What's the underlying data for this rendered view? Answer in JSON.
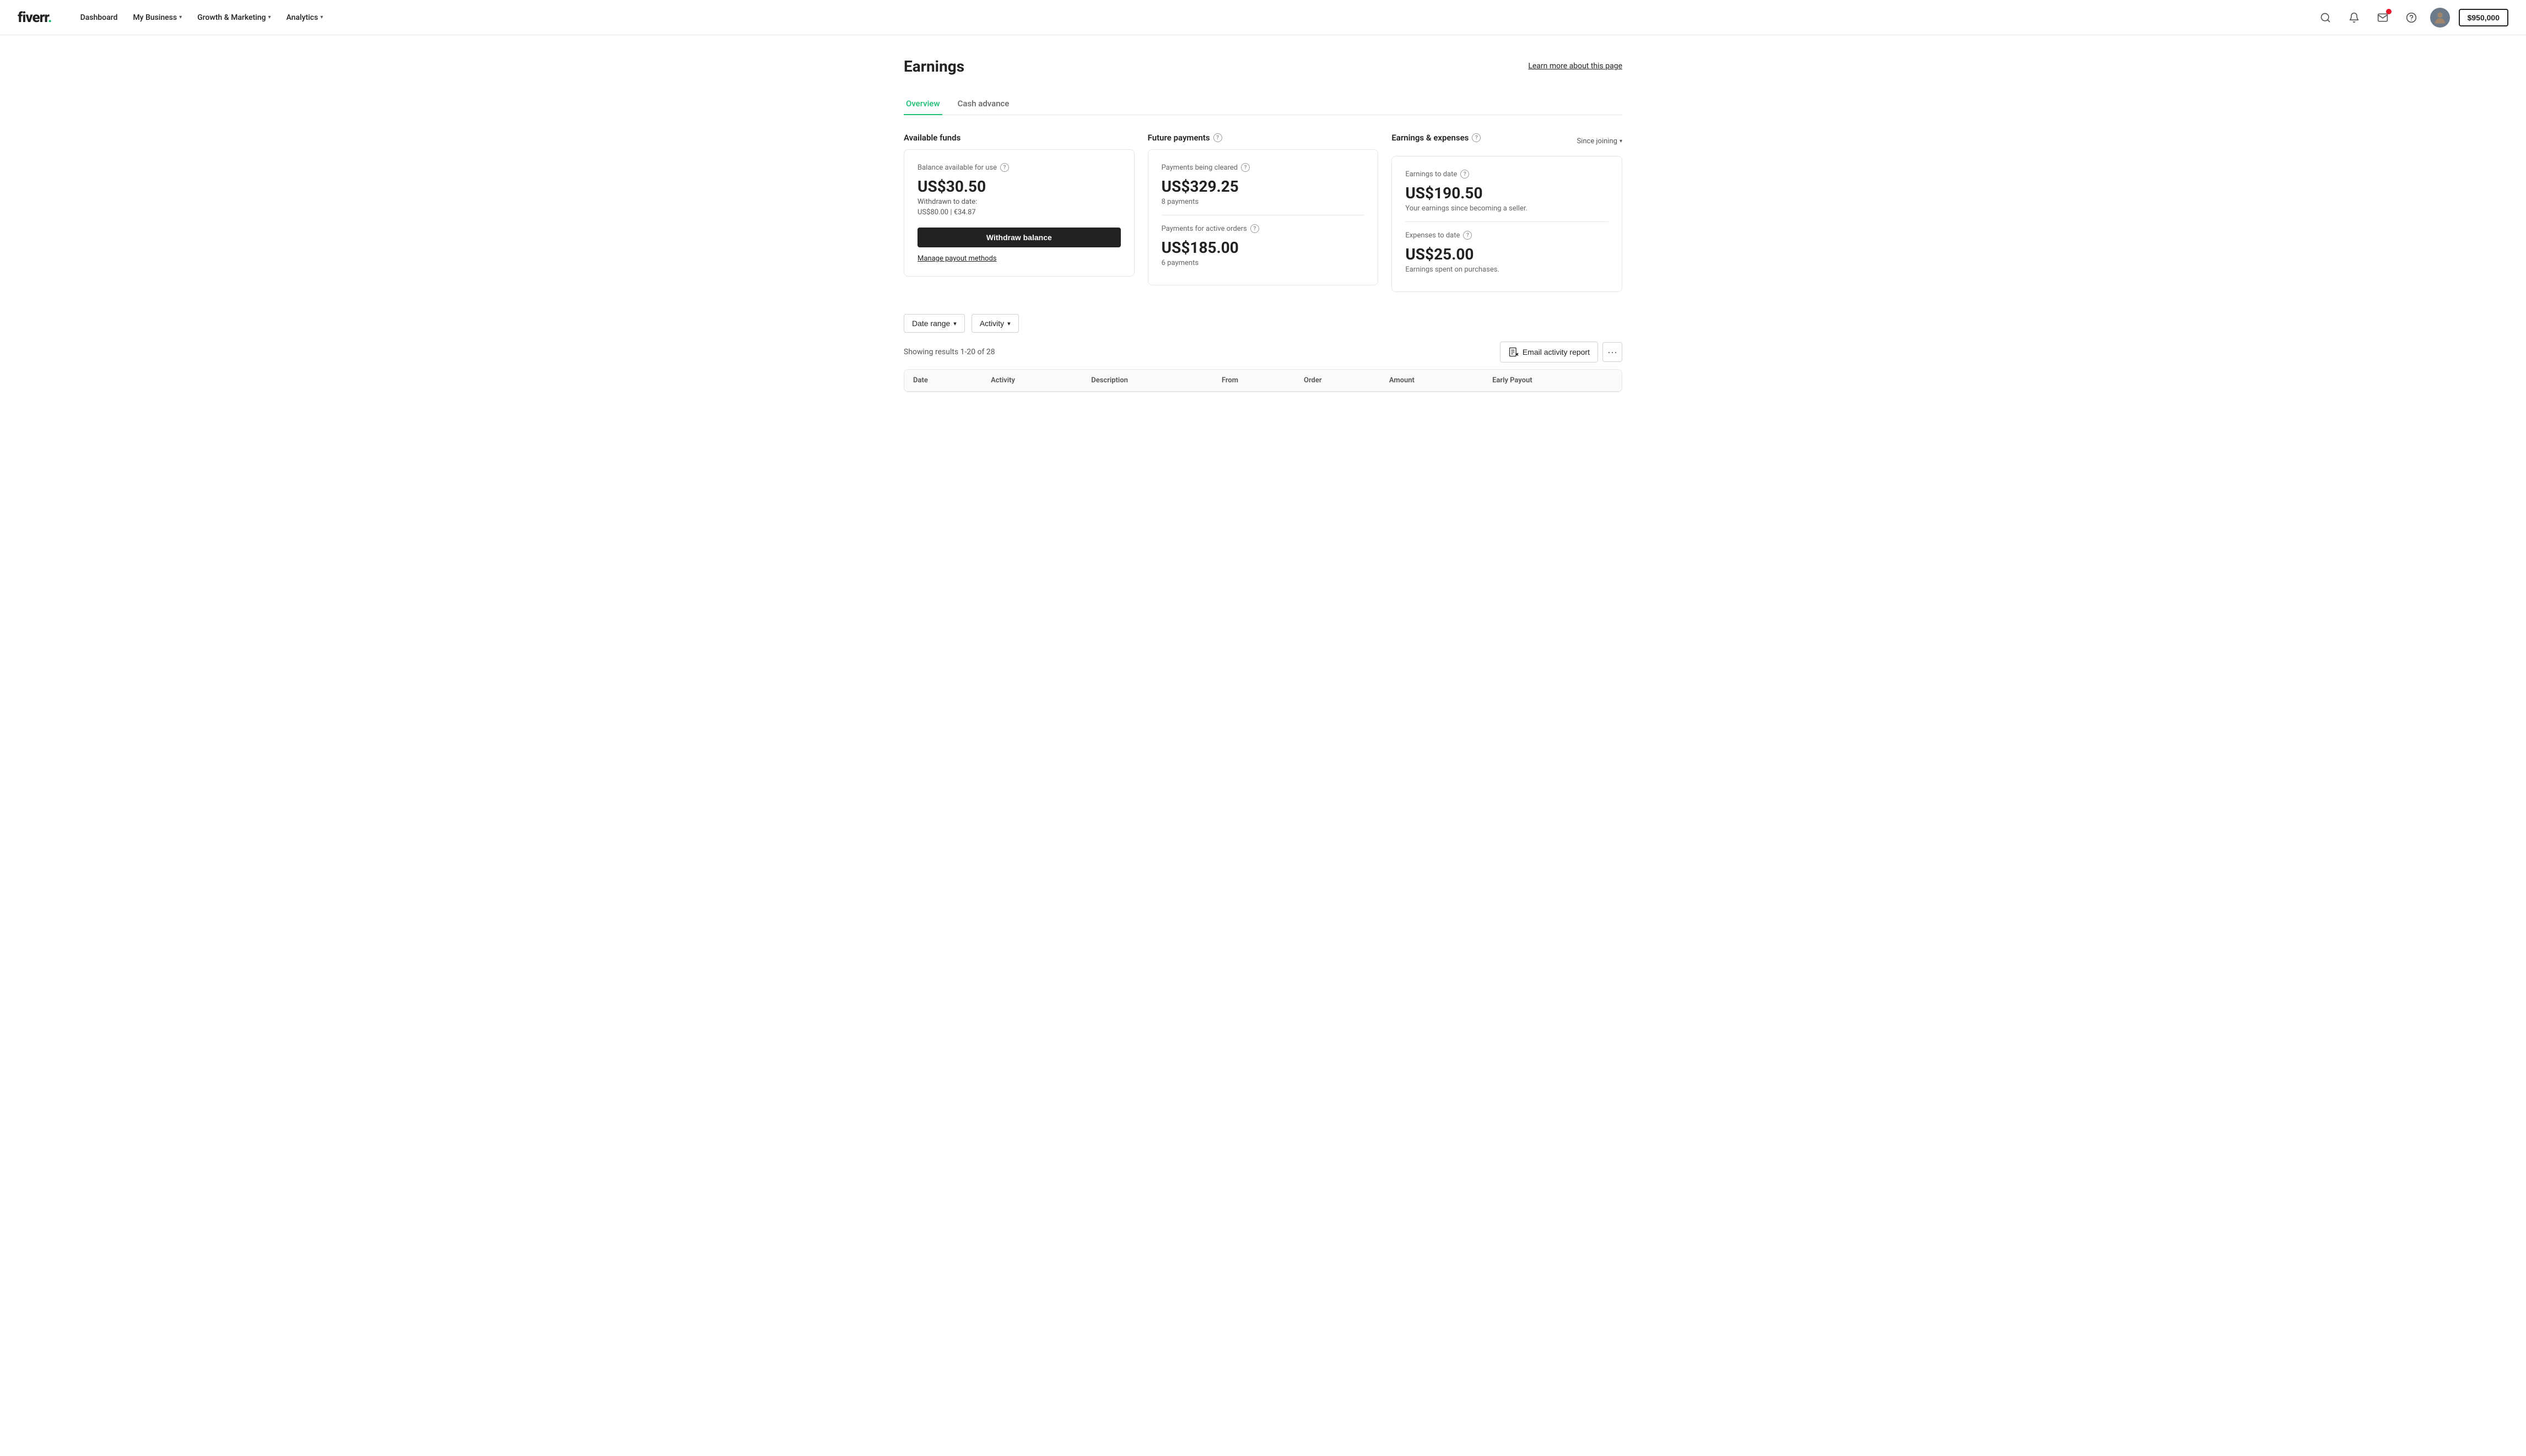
{
  "brand": {
    "logo_text": "fiverr",
    "logo_dot": "."
  },
  "navbar": {
    "links": [
      {
        "id": "dashboard",
        "label": "Dashboard",
        "has_dropdown": false
      },
      {
        "id": "my-business",
        "label": "My Business",
        "has_dropdown": true
      },
      {
        "id": "growth-marketing",
        "label": "Growth & Marketing",
        "has_dropdown": true
      },
      {
        "id": "analytics",
        "label": "Analytics",
        "has_dropdown": true
      }
    ],
    "balance": "$950,000"
  },
  "page": {
    "title": "Earnings",
    "learn_more_label": "Learn more about this page"
  },
  "tabs": [
    {
      "id": "overview",
      "label": "Overview",
      "active": true
    },
    {
      "id": "cash-advance",
      "label": "Cash advance",
      "active": false
    }
  ],
  "available_funds": {
    "section_label": "Available funds",
    "balance_label": "Balance available for use",
    "balance_amount": "US$30.50",
    "withdrawn_label": "Withdrawn to date:",
    "withdrawn_amounts": "US$80.00  |  €34.87",
    "withdraw_btn_label": "Withdraw balance",
    "manage_link_label": "Manage payout methods"
  },
  "future_payments": {
    "section_label": "Future payments",
    "clearing_label": "Payments being cleared",
    "clearing_amount": "US$329.25",
    "clearing_count": "8 payments",
    "active_label": "Payments for active orders",
    "active_amount": "US$185.00",
    "active_count": "6 payments"
  },
  "earnings_expenses": {
    "section_label": "Earnings & expenses",
    "since_joining_label": "Since joining",
    "earnings_label": "Earnings to date",
    "earnings_amount": "US$190.50",
    "earnings_sub": "Your earnings since becoming a seller.",
    "expenses_label": "Expenses to date",
    "expenses_amount": "US$25.00",
    "expenses_sub": "Earnings spent on purchases."
  },
  "filters": {
    "date_range_label": "Date range",
    "activity_label": "Activity"
  },
  "results": {
    "showing_text": "Showing results 1-20 of 28",
    "email_report_label": "Email activity report",
    "more_options_icon": "···"
  },
  "table": {
    "columns": [
      "Date",
      "Activity",
      "Description",
      "From",
      "Order",
      "Amount",
      "Early Payout"
    ],
    "rows": []
  }
}
